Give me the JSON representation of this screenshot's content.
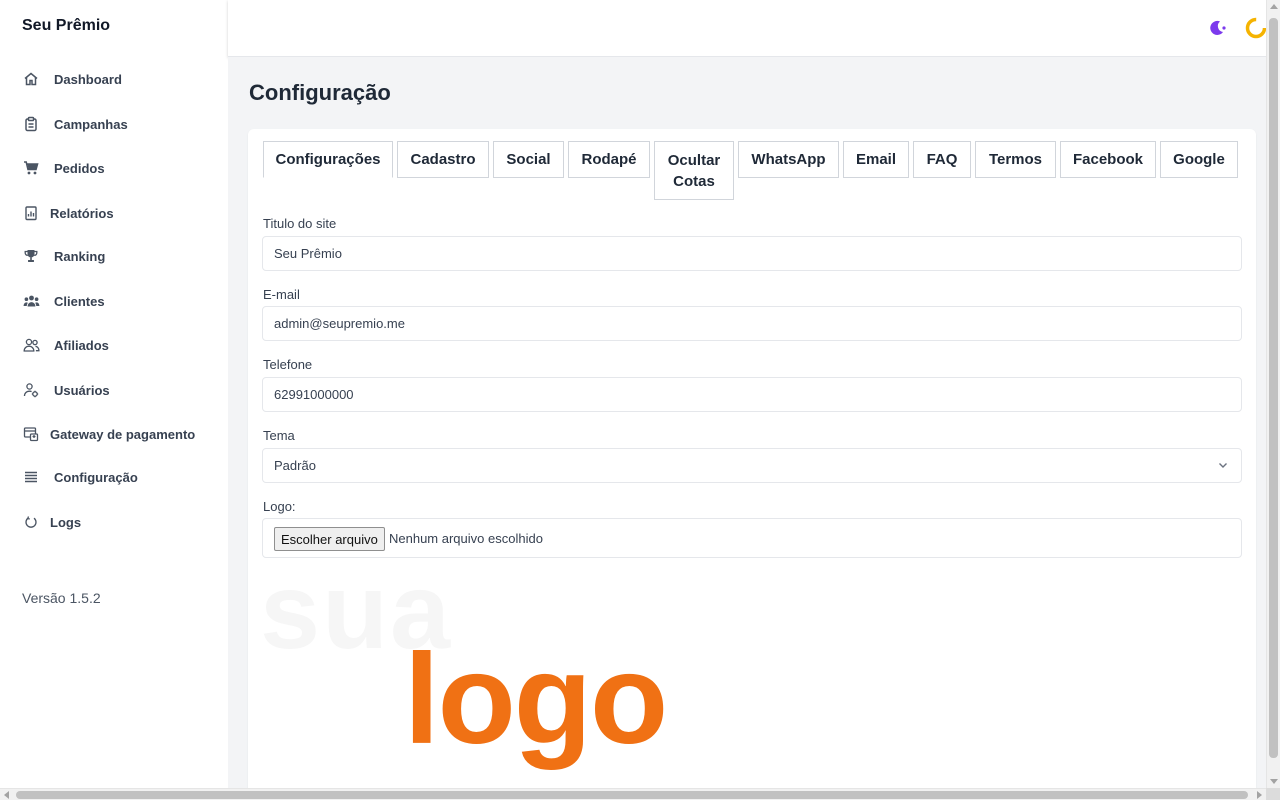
{
  "app": {
    "brand": "Seu Prêmio",
    "version": "Versão 1.5.2"
  },
  "sidebar": {
    "items": [
      {
        "label": "Dashboard",
        "icon": "home-icon"
      },
      {
        "label": "Campanhas",
        "icon": "clipboard-icon"
      },
      {
        "label": "Pedidos",
        "icon": "cart-icon"
      },
      {
        "label": "Relatórios",
        "icon": "report-icon"
      },
      {
        "label": "Ranking",
        "icon": "trophy-icon"
      },
      {
        "label": "Clientes",
        "icon": "users-icon"
      },
      {
        "label": "Afiliados",
        "icon": "affiliates-icon"
      },
      {
        "label": "Usuários",
        "icon": "user-settings-icon"
      },
      {
        "label": "Gateway de pagamento",
        "icon": "payment-icon"
      },
      {
        "label": "Configuração",
        "icon": "menu-lines-icon"
      },
      {
        "label": "Logs",
        "icon": "power-icon"
      }
    ]
  },
  "header": {
    "theme_toggle_icon": "moon-icon",
    "status_icon": "loading-ring-icon"
  },
  "page": {
    "title": "Configuração"
  },
  "tabs": [
    {
      "label": "Configurações",
      "active": true
    },
    {
      "label": "Cadastro"
    },
    {
      "label": "Social"
    },
    {
      "label": "Rodapé"
    },
    {
      "label": "Ocultar Cotas"
    },
    {
      "label": "WhatsApp"
    },
    {
      "label": "Email"
    },
    {
      "label": "FAQ"
    },
    {
      "label": "Termos"
    },
    {
      "label": "Facebook"
    },
    {
      "label": "Google"
    }
  ],
  "form": {
    "site_title": {
      "label": "Titulo do site",
      "value": "Seu Prêmio"
    },
    "email": {
      "label": "E-mail",
      "value": "admin@seupremio.me"
    },
    "phone": {
      "label": "Telefone",
      "value": "62991000000"
    },
    "theme": {
      "label": "Tema",
      "value": "Padrão"
    },
    "logo": {
      "label": "Logo:",
      "button": "Escolher arquivo",
      "status": "Nenhum arquivo escolhido"
    }
  },
  "logo_preview": {
    "line1": "sua",
    "line2": "logo"
  },
  "colors": {
    "accent_purple": "#7c3aed",
    "logo_orange": "#f07114",
    "ring_yellow": "#f5b301"
  }
}
